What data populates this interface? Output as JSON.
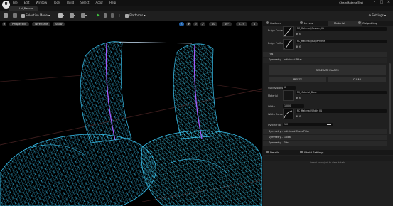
{
  "titlebar": {
    "menu": [
      "File",
      "Edit",
      "Window",
      "Tools",
      "Build",
      "Select",
      "Actor",
      "Help"
    ],
    "project": "ChainMaterialTest"
  },
  "tab": {
    "label": "Lvl_Banner"
  },
  "toolbar": {
    "mode_label": "Selection Mode",
    "platforms_label": "Platforms",
    "settings_label": "Settings"
  },
  "viewport": {
    "perspective_label": "Perspective",
    "wireframe_label": "Wireframe",
    "show_label": "Show",
    "grid_value": "10",
    "angle_value": "10°",
    "scale_value": "0.25",
    "camera_value": "4"
  },
  "outliner": {
    "tab_label": "Outliner",
    "tab2_label": "Levels",
    "tab3_label": "Material",
    "tab4_label": "Output Log"
  },
  "properties": {
    "bulge_curve_label": "Bulge Curve",
    "bulge_curve_value": "FC_Material_Custom_01",
    "bulge_profile_label": "Bulge Profile",
    "bulge_profile_value": "FC_Material_BulgeProfile",
    "fill_section": "Fills",
    "symmetry_section": "Symmetry - Individual Pillar",
    "generate_button": "GENERATE PLANES",
    "freeze_button": "FREEZE",
    "clear_button": "CLEAR",
    "subdivisions_label": "Subdivisions",
    "subdivisions_value": "6",
    "material_label": "Material",
    "material_value": "MI_Material_Base",
    "width_label": "Width",
    "width_value": "100.0",
    "width_curve_label": "Width Curve",
    "width_curve_value": "FC_Material_Width_01",
    "uv_label": "Uv/cm Flip",
    "uv_value": "1.0",
    "section_a": "Symmetry - Individual Cross Pillar",
    "section_b": "Symmetry - Global",
    "section_c": "Symmetry - Tilts"
  },
  "details": {
    "tab_label": "Details",
    "tab2_label": "World Settings",
    "empty_text": "Select an object to view details."
  }
}
